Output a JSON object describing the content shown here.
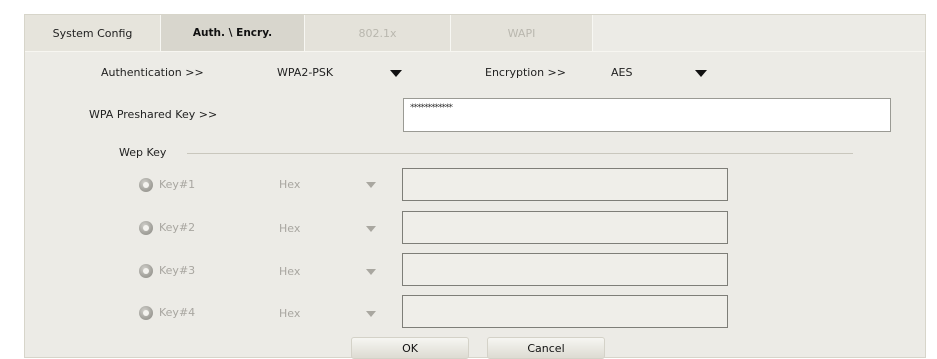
{
  "tabs": [
    {
      "label": "System Config"
    },
    {
      "label": "Auth. \\ Encry."
    },
    {
      "label": "802.1x"
    },
    {
      "label": "WAPI"
    }
  ],
  "auth": {
    "authentication_label": "Authentication >>",
    "authentication_value": "WPA2-PSK",
    "encryption_label": "Encryption >>",
    "encryption_value": "AES"
  },
  "psk": {
    "label": "WPA Preshared Key >>",
    "value": "************"
  },
  "wep": {
    "group_label": "Wep Key",
    "keys": [
      {
        "label": "Key#1",
        "format": "Hex",
        "value": ""
      },
      {
        "label": "Key#2",
        "format": "Hex",
        "value": ""
      },
      {
        "label": "Key#3",
        "format": "Hex",
        "value": ""
      },
      {
        "label": "Key#4",
        "format": "Hex",
        "value": ""
      }
    ]
  },
  "buttons": {
    "ok": "OK",
    "cancel": "Cancel"
  }
}
